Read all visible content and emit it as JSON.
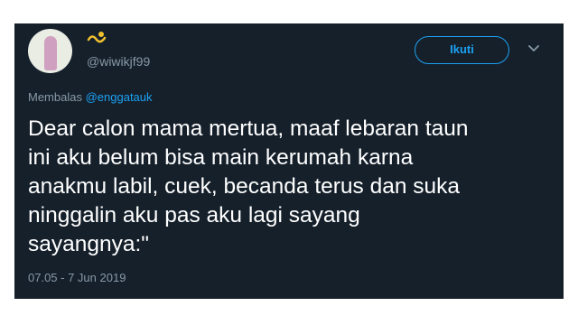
{
  "tweet": {
    "display_name": "",
    "name_emoji": "wave-sun-emoji",
    "username": "@wiwikjf99",
    "follow_label": "Ikuti",
    "reply_prefix": "Membalas",
    "reply_to": "@enggatauk",
    "text_lines": [
      "Dear calon mama mertua, maaf lebaran taun",
      "ini aku belum bisa main kerumah karna",
      "anakmu labil, cuek, becanda terus dan suka",
      "ninggalin aku pas aku lagi sayang",
      "sayangnya:\""
    ],
    "timestamp": "07.05 - 7 Jun 2019"
  },
  "colors": {
    "card_background": "#15202b",
    "accent": "#1da1f2",
    "secondary_text": "#8899a6",
    "primary_text": "#ffffff",
    "page_background": "#ffffff"
  },
  "icons": {
    "menu": "chevron-down-icon",
    "avatar": "profile-avatar"
  }
}
